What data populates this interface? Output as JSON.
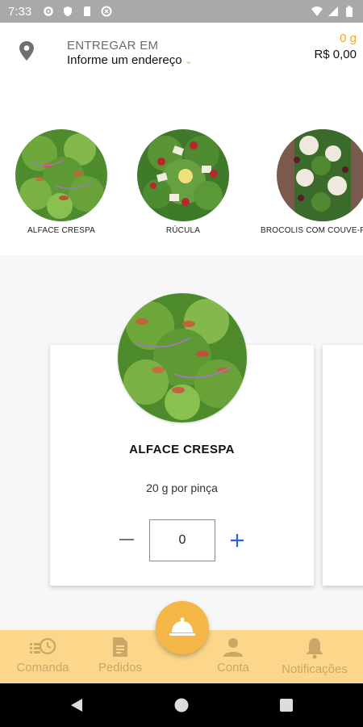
{
  "status_bar": {
    "time": "7:33"
  },
  "header": {
    "deliver_label": "ENTREGAR EM",
    "address_placeholder": "Informe um endereço",
    "cart_weight": "0 g",
    "cart_price": "R$ 0,00"
  },
  "categories": [
    {
      "label": "ALFACE CRESPA",
      "image": "lettuce-salad"
    },
    {
      "label": "RÚCULA",
      "image": "arugula-salad"
    },
    {
      "label": "BROCOLIS COM COUVE-F",
      "image": "broccoli-cauliflower-salad"
    }
  ],
  "product": {
    "name": "ALFACE CRESPA",
    "unit": "20 g por pinça",
    "quantity": "0"
  },
  "bottom_nav": {
    "items": [
      {
        "label": "Comanda",
        "icon": "order-history-icon"
      },
      {
        "label": "Pedidos",
        "icon": "document-icon"
      },
      {
        "label": "Conta",
        "icon": "person-icon"
      },
      {
        "label": "Notificações",
        "icon": "bell-icon"
      }
    ],
    "center_icon": "cloche-icon"
  },
  "colors": {
    "accent": "#f4b747",
    "nav_bg": "#fcd68b",
    "nav_text": "#c9a766",
    "weight_orange": "#f2a91a",
    "plus_blue": "#2f5fe0"
  }
}
